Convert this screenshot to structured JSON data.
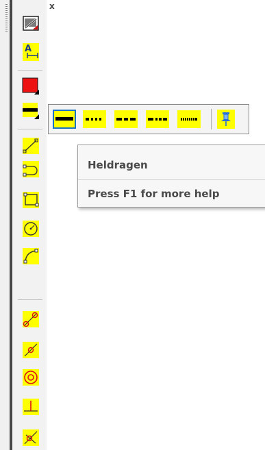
{
  "toolbar": {
    "close_glyph": "x",
    "buttons": [
      {
        "name": "properties-icon"
      },
      {
        "name": "dimension-text-icon",
        "label": "A"
      },
      {
        "name": "color-red-icon",
        "color": "#ee1111"
      },
      {
        "name": "line-type-icon"
      },
      {
        "name": "line-tool-icon"
      },
      {
        "name": "polyline-tool-icon"
      },
      {
        "name": "rectangle-tool-icon"
      },
      {
        "name": "circle-tool-icon"
      },
      {
        "name": "arc-tool-icon"
      },
      {
        "name": "snap-endpoint-icon"
      },
      {
        "name": "snap-midpoint-icon"
      },
      {
        "name": "snap-center-icon"
      },
      {
        "name": "snap-perpendicular-icon"
      },
      {
        "name": "snap-intersection-icon"
      }
    ]
  },
  "line_types": [
    {
      "name": "line-solid-icon",
      "selected": true
    },
    {
      "name": "line-dotted-icon"
    },
    {
      "name": "line-dashed-icon"
    },
    {
      "name": "line-dash-dot-icon"
    },
    {
      "name": "line-fine-dotted-icon"
    },
    {
      "name": "pin-icon"
    }
  ],
  "tooltip": {
    "title": "Heldragen",
    "help": "Press F1 for more help"
  },
  "colors": {
    "icon_yellow": "#ffff00",
    "selection_blue": "#1a72c4",
    "red": "#ee1111"
  }
}
